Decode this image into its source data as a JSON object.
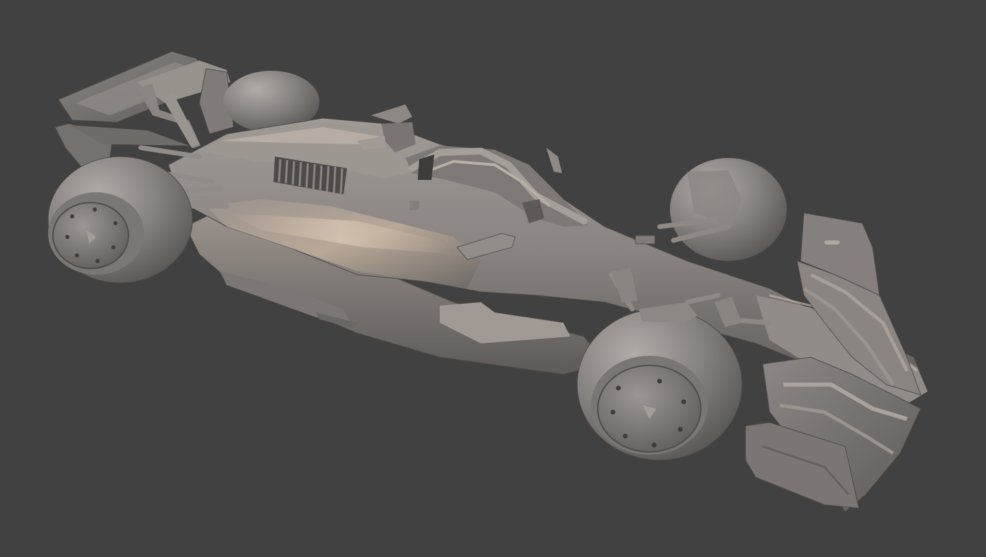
{
  "scene": {
    "subject": "clay-render-formula-car",
    "background_color": "#414141",
    "material_base": "#8a8a8a",
    "material_highlight": "#c4bdb5",
    "material_shadow": "#4a4a4a",
    "warm_light_color": "#e0b080"
  }
}
